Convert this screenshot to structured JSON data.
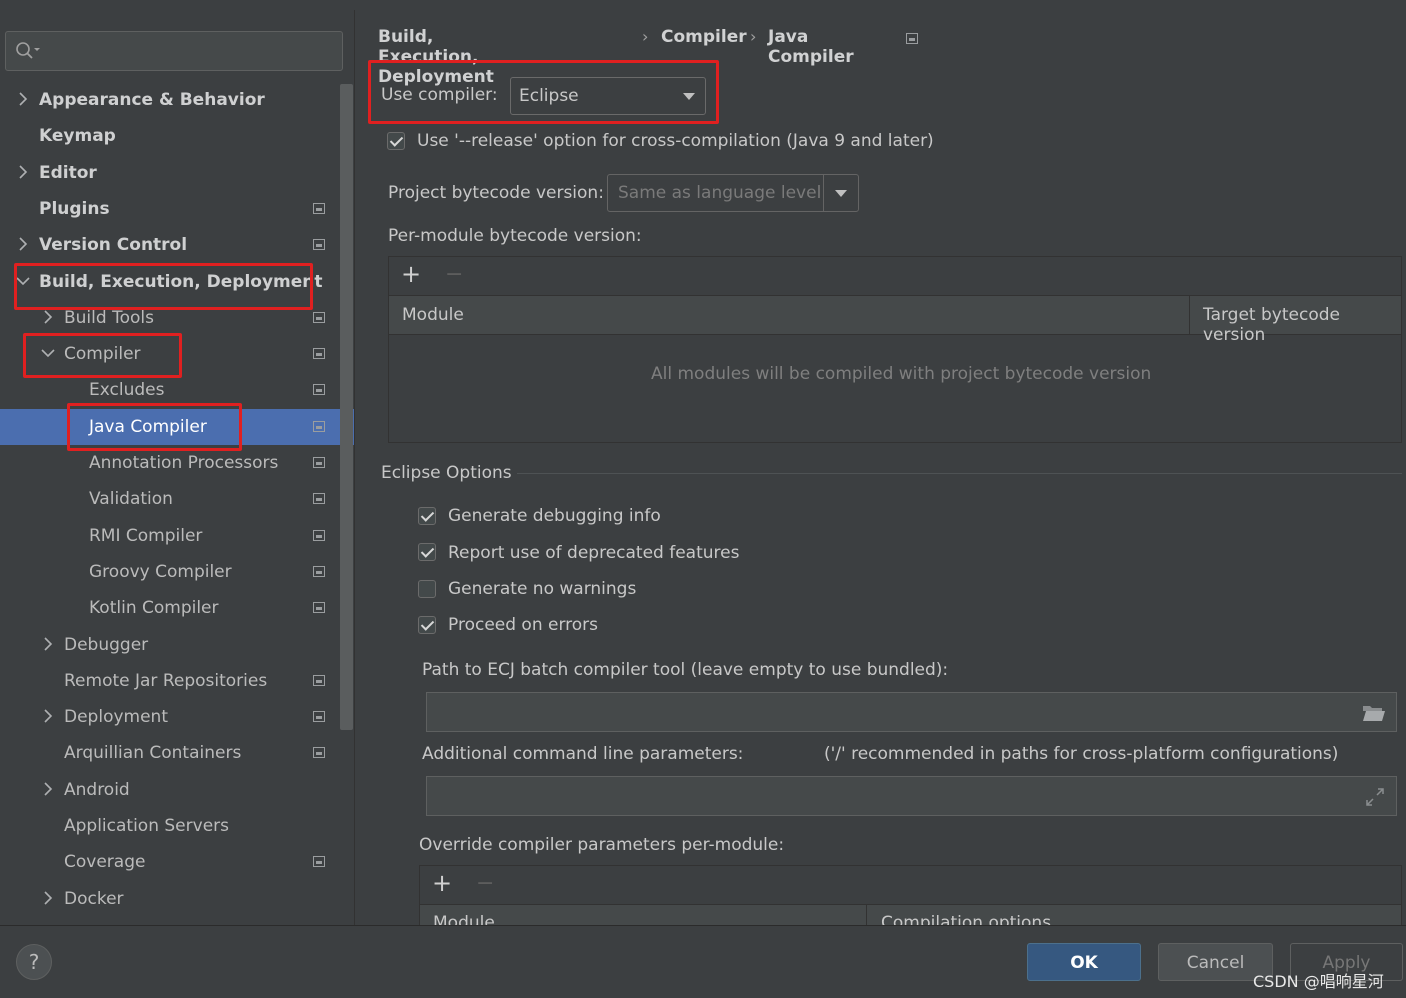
{
  "window": {
    "title": "Settings"
  },
  "search": {
    "placeholder": ""
  },
  "sidebar": {
    "items": [
      {
        "label": "Appearance & Behavior",
        "expandable": true,
        "expanded": false,
        "bold": true,
        "level": 0
      },
      {
        "label": "Keymap",
        "expandable": false,
        "bold": true,
        "level": 0
      },
      {
        "label": "Editor",
        "expandable": true,
        "expanded": false,
        "bold": true,
        "level": 0
      },
      {
        "label": "Plugins",
        "expandable": false,
        "bold": true,
        "level": 0,
        "project_icon": true
      },
      {
        "label": "Version Control",
        "expandable": true,
        "expanded": false,
        "bold": true,
        "level": 0,
        "project_icon": true
      },
      {
        "label": "Build, Execution, Deployment",
        "expandable": true,
        "expanded": true,
        "bold": true,
        "level": 0
      },
      {
        "label": "Build Tools",
        "expandable": true,
        "expanded": false,
        "level": 1,
        "project_icon": true
      },
      {
        "label": "Compiler",
        "expandable": true,
        "expanded": true,
        "level": 1,
        "project_icon": true
      },
      {
        "label": "Excludes",
        "level": 2,
        "project_icon": true
      },
      {
        "label": "Java Compiler",
        "level": 2,
        "project_icon": true,
        "selected": true
      },
      {
        "label": "Annotation Processors",
        "level": 2,
        "project_icon": true
      },
      {
        "label": "Validation",
        "level": 2,
        "project_icon": true
      },
      {
        "label": "RMI Compiler",
        "level": 2,
        "project_icon": true
      },
      {
        "label": "Groovy Compiler",
        "level": 2,
        "project_icon": true
      },
      {
        "label": "Kotlin Compiler",
        "level": 2,
        "project_icon": true
      },
      {
        "label": "Debugger",
        "expandable": true,
        "expanded": false,
        "level": 1
      },
      {
        "label": "Remote Jar Repositories",
        "level": 1,
        "project_icon": true
      },
      {
        "label": "Deployment",
        "expandable": true,
        "expanded": false,
        "level": 1,
        "project_icon": true
      },
      {
        "label": "Arquillian Containers",
        "level": 1,
        "project_icon": true
      },
      {
        "label": "Android",
        "expandable": true,
        "expanded": false,
        "level": 1
      },
      {
        "label": "Application Servers",
        "level": 1
      },
      {
        "label": "Coverage",
        "level": 1,
        "project_icon": true
      },
      {
        "label": "Docker",
        "expandable": true,
        "expanded": false,
        "level": 1
      }
    ]
  },
  "breadcrumb": {
    "parts": [
      "Build, Execution, Deployment",
      "Compiler",
      "Java Compiler"
    ],
    "separator": "›"
  },
  "compiler": {
    "use_compiler_label": "Use compiler:",
    "use_compiler_value": "Eclipse",
    "release_option_label": "Use '--release' option for cross-compilation (Java 9 and later)",
    "release_option_checked": true,
    "bytecode_label": "Project bytecode version:",
    "bytecode_value": "Same as language level",
    "per_module_label": "Per-module bytecode version:",
    "module_table": {
      "columns": [
        "Module",
        "Target bytecode version"
      ],
      "empty_text": "All modules will be compiled with project bytecode version",
      "add": "+",
      "remove": "−"
    }
  },
  "eclipse": {
    "section_title": "Eclipse Options",
    "options": [
      {
        "label": "Generate debugging info",
        "checked": true
      },
      {
        "label": "Report use of deprecated features",
        "checked": true
      },
      {
        "label": "Generate no warnings",
        "checked": false
      },
      {
        "label": "Proceed on errors",
        "checked": true
      }
    ],
    "ecj_path_label": "Path to ECJ batch compiler tool (leave empty to use bundled):",
    "ecj_path_value": "",
    "additional_params_label": "Additional command line parameters:",
    "additional_params_hint": "('/' recommended in paths for cross-platform configurations)",
    "additional_params_value": "",
    "override_label": "Override compiler parameters per-module:",
    "override_table": {
      "columns": [
        "Module",
        "Compilation options"
      ],
      "add": "+",
      "remove": "−"
    }
  },
  "footer": {
    "help": "?",
    "ok": "OK",
    "cancel": "Cancel",
    "apply": "Apply"
  },
  "watermark": "CSDN @唱响星河",
  "colors": {
    "background": "#3c3f41",
    "selection": "#4b6eaf",
    "ok_button": "#365880",
    "highlight_box": "#e02020"
  }
}
